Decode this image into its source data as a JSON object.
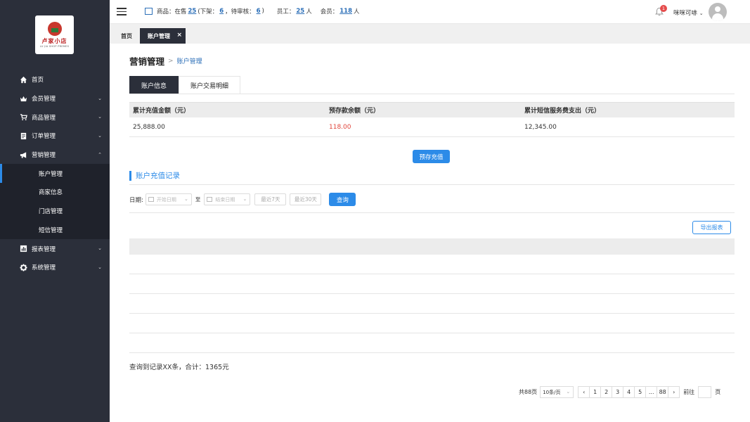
{
  "sidebar": {
    "logo_text": "卢家小店",
    "logo_sub": "LU JIA SHOP PREMES",
    "items": [
      {
        "label": "首页",
        "icon": "home-icon"
      },
      {
        "label": "会员管理",
        "icon": "crown-icon"
      },
      {
        "label": "商品管理",
        "icon": "cart-icon"
      },
      {
        "label": "订单管理",
        "icon": "document-icon"
      },
      {
        "label": "营销管理",
        "icon": "megaphone-icon"
      }
    ],
    "sub_items": [
      "账户管理",
      "商家信息",
      "门店管理",
      "短信管理"
    ],
    "items_after": [
      {
        "label": "报表管理",
        "icon": "bar-chart-icon"
      },
      {
        "label": "系统管理",
        "icon": "settings-gear-icon"
      }
    ]
  },
  "topbar": {
    "goods_label": "商品：在售",
    "goods_on_sale": "25",
    "off_shelf_label": "(下架：",
    "off_shelf": "6",
    "pending_label": "，待审核：",
    "pending": "6",
    "pending_close": ")",
    "staff_label": "员工：",
    "staff": "25",
    "staff_unit": "人",
    "member_label": "会员：",
    "members": "118",
    "member_unit": "人",
    "notification_count": "1",
    "user_name": "咪咪可哧"
  },
  "tabs": {
    "home": "首页",
    "active": "账户管理",
    "close": "×"
  },
  "breadcrumb": {
    "main": "营销管理",
    "sep": ">",
    "sub": "账户管理"
  },
  "subtabs": [
    "账户信息",
    "账户交易明细"
  ],
  "account_info": {
    "headers": [
      "累计充值金额（元）",
      "预存款余额（元）",
      "累计短信服务费支出（元）"
    ],
    "values": [
      "25,888.00",
      "118.00",
      "12,345.00"
    ]
  },
  "recharge_button": "预存充值",
  "records_title": "账户充值记录",
  "filters": {
    "date_label": "日期:",
    "start_placeholder": "开始日期",
    "to_label": "至",
    "end_placeholder": "结束日期",
    "last7": "最近7天",
    "last30": "最近30天",
    "query": "查询"
  },
  "export_button": "导出报表",
  "summary": "查询到记录XX条，合计：1365元",
  "pagination": {
    "total": "共88页",
    "page_size": "10条/页",
    "prev": "‹",
    "pages": [
      "1",
      "2",
      "3",
      "4",
      "5",
      "...",
      "88"
    ],
    "next": "›",
    "goto_label": "前往",
    "page_unit": "页"
  }
}
